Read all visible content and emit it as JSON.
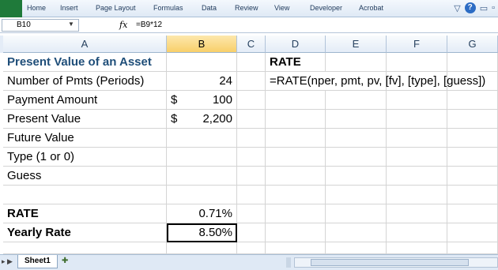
{
  "ribbon": {
    "tabs": [
      "Home",
      "Insert",
      "Page Layout",
      "Formulas",
      "Data",
      "Review",
      "View",
      "Developer",
      "Acrobat"
    ]
  },
  "formula_bar": {
    "name_box": "B10",
    "fx_label": "fx",
    "formula": "=B9*12"
  },
  "columns": [
    "A",
    "B",
    "C",
    "D",
    "E",
    "F",
    "G"
  ],
  "selected_column": "B",
  "rows": [
    {
      "a": "Present Value of an Asset",
      "b": "",
      "d": "RATE"
    },
    {
      "a": "Number of Pmts (Periods)",
      "b": "24",
      "d": "=RATE(nper, pmt, pv, [fv], [type], [guess])"
    },
    {
      "a": "Payment Amount",
      "b_currency": "$",
      "b": "100",
      "d": ""
    },
    {
      "a": "Present Value",
      "b_currency": "$",
      "b": "2,200",
      "d": ""
    },
    {
      "a": "Future Value",
      "b": "",
      "d": ""
    },
    {
      "a": "Type (1 or 0)",
      "b": "",
      "d": ""
    },
    {
      "a": "Guess",
      "b": "",
      "d": ""
    },
    {
      "a": "",
      "b": "",
      "d": ""
    },
    {
      "a": "RATE",
      "b": "0.71%",
      "d": ""
    },
    {
      "a": "Yearly Rate",
      "b": "8.50%",
      "d": ""
    }
  ],
  "sheets": [
    "Sheet1"
  ],
  "colors": {
    "title_blue": "#1f4e79",
    "selected_header": "#f8cf6a",
    "file_tab": "#1f7a3a"
  }
}
